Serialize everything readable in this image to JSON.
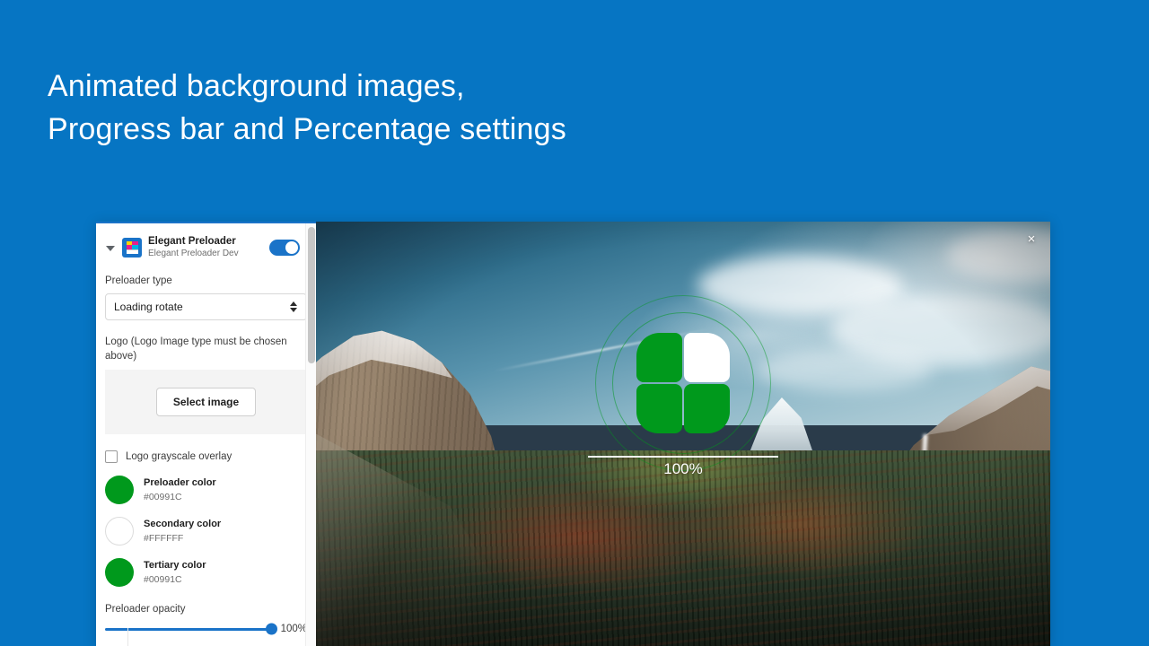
{
  "headline": "Animated background images,\nProgress bar and Percentage settings",
  "theme": {
    "background": "#0675C3",
    "accent": "#1A73C8",
    "preloader_green": "#00991C"
  },
  "panel": {
    "app": {
      "name": "Elegant Preloader",
      "subtitle": "Elegant Preloader Dev",
      "icon": "app-tile-icon",
      "caret": "caret-down-icon",
      "toggle_state": "on"
    },
    "preloader_type": {
      "label": "Preloader type",
      "value": "Loading rotate",
      "options": [
        "Loading rotate"
      ]
    },
    "logo": {
      "label": "Logo (Logo Image type must be chosen above)",
      "button": "Select image"
    },
    "grayscale": {
      "label": "Logo grayscale overlay",
      "checked": false
    },
    "colors": [
      {
        "name": "Preloader color",
        "hex": "#00991C",
        "swatch": "#00991C"
      },
      {
        "name": "Secondary color",
        "hex": "#FFFFFF",
        "swatch": "#FFFFFF"
      },
      {
        "name": "Tertiary color",
        "hex": "#00991C",
        "swatch": "#00991C"
      }
    ],
    "opacity": {
      "label": "Preloader opacity",
      "value": "100%",
      "percent": 100
    }
  },
  "preview": {
    "close_icon": "×",
    "progress": {
      "percent_label": "100%",
      "percent": 100
    },
    "logo_mark": "four-petal-logo",
    "background_image": "yosemite-valley-landscape"
  }
}
